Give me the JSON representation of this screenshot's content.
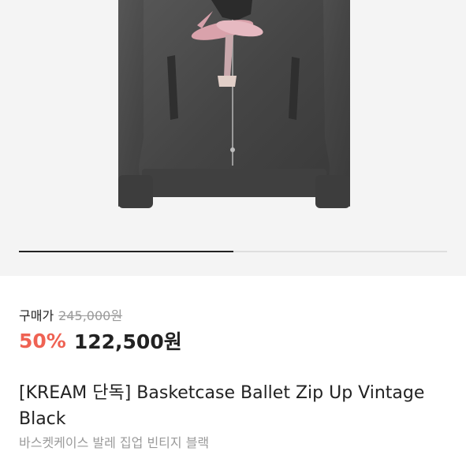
{
  "product_image": {
    "alt": "Basketcase Ballet Zip Up Vintage Black"
  },
  "gallery": {
    "progress": 0.5
  },
  "price": {
    "buy_label": "구매가",
    "original": "245,000원",
    "discount": "50%",
    "sale": "122,500원"
  },
  "product": {
    "title": "[KREAM 단독] Basketcase Ballet Zip Up Vintage Black",
    "subtitle": "바스켓케이스 발레 집업 빈티지 블랙"
  },
  "colors": {
    "garment": "#4a4a4a",
    "discount": "#ef6253",
    "muted_text": "#9a9a9a"
  }
}
